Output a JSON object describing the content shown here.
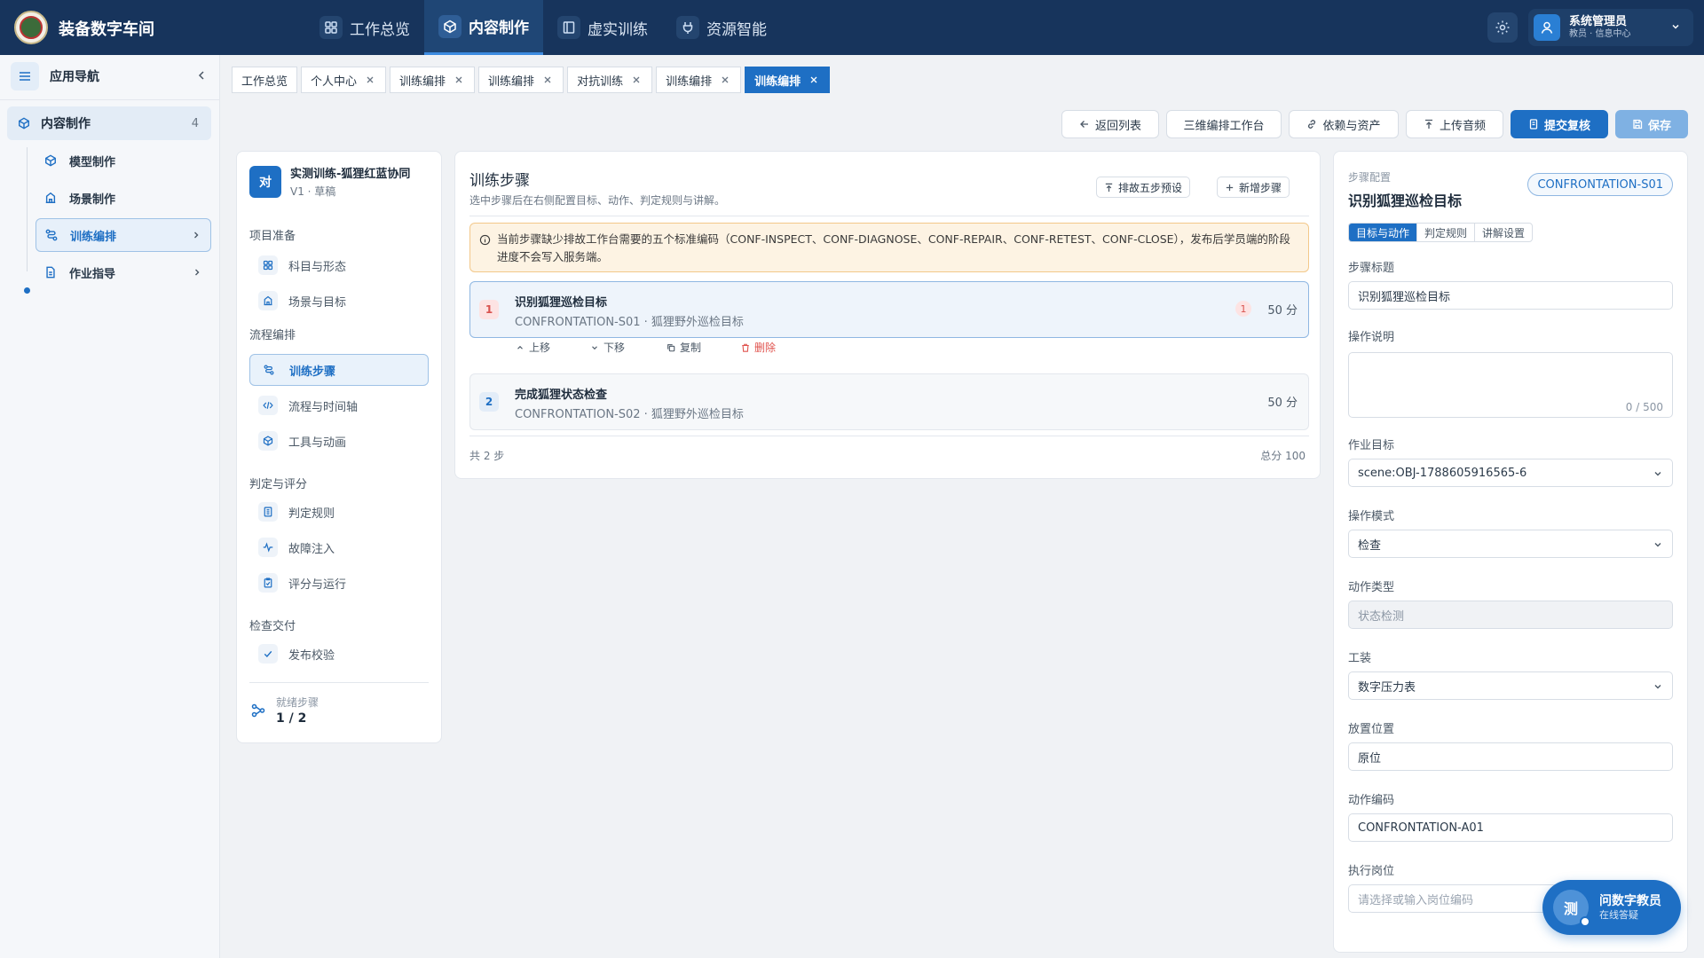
{
  "app": {
    "title": "装备数字车间"
  },
  "topnav": [
    {
      "label": "工作总览",
      "icon": "grid-icon"
    },
    {
      "label": "内容制作",
      "icon": "cube-icon"
    },
    {
      "label": "虚实训练",
      "icon": "book-icon"
    },
    {
      "label": "资源智能",
      "icon": "plug-icon"
    }
  ],
  "user": {
    "name": "系统管理员",
    "sub": "教员 · 信息中心"
  },
  "sidenav": {
    "title": "应用导航",
    "group": {
      "label": "内容制作",
      "count": "4"
    },
    "items": [
      {
        "label": "模型制作",
        "icon": "cube-icon"
      },
      {
        "label": "场景制作",
        "icon": "building-icon"
      },
      {
        "label": "训练编排",
        "icon": "flow-icon"
      },
      {
        "label": "作业指导",
        "icon": "document-icon"
      }
    ]
  },
  "tabs": [
    "工作总览",
    "个人中心",
    "训练编排",
    "训练编排",
    "对抗训练",
    "训练编排",
    "训练编排"
  ],
  "actions": {
    "back": "返回列表",
    "workbench": "三维编排工作台",
    "deps": "依赖与资产",
    "upload": "上传音频",
    "submit": "提交复核",
    "save": "保存"
  },
  "project": {
    "avatar": "对",
    "name": "实测训练-狐狸红蓝协同",
    "version": "V1 · 草稿",
    "sections": [
      {
        "title": "项目准备",
        "items": [
          "科目与形态",
          "场景与目标"
        ]
      },
      {
        "title": "流程编排",
        "items": [
          "训练步骤",
          "流程与时间轴",
          "工具与动画"
        ]
      },
      {
        "title": "判定与评分",
        "items": [
          "判定规则",
          "故障注入",
          "评分与运行"
        ]
      },
      {
        "title": "检查交付",
        "items": [
          "发布校验"
        ]
      }
    ],
    "ready_label": "就绪步骤",
    "ready_value": "1 / 2"
  },
  "steps": {
    "title": "训练步骤",
    "subtitle": "选中步骤后在右侧配置目标、动作、判定规则与讲解。",
    "preset_btn": "排故五步预设",
    "add_btn": "新增步骤",
    "warning": "当前步骤缺少排故工作台需要的五个标准编码（CONF-INSPECT、CONF-DIAGNOSE、CONF-REPAIR、CONF-RETEST、CONF-CLOSE），发布后学员端的阶段进度不会写入服务端。",
    "list": [
      {
        "num": "1",
        "name": "识别狐狸巡检目标",
        "code": "CONFRONTATION-S01 · 狐狸野外巡检目标",
        "badge": "1",
        "score": "50 分"
      },
      {
        "num": "2",
        "name": "完成狐狸状态检查",
        "code": "CONFRONTATION-S02 · 狐狸野外巡检目标",
        "score": "50 分"
      }
    ],
    "step_actions": {
      "up": "上移",
      "down": "下移",
      "copy": "复制",
      "delete": "删除"
    },
    "count": "共 2 步",
    "total": "总分 100"
  },
  "config": {
    "label": "步骤配置",
    "title": "识别狐狸巡检目标",
    "code": "CONFRONTATION-S01",
    "tabs": [
      "目标与动作",
      "判定规则",
      "讲解设置"
    ],
    "fields": {
      "step_title_label": "步骤标题",
      "step_title": "识别狐狸巡检目标",
      "desc_label": "操作说明",
      "desc_count": "0 / 500",
      "target_label": "作业目标",
      "target": "scene:OBJ-1788605916565-6",
      "mode_label": "操作模式",
      "mode": "检查",
      "action_type_label": "动作类型",
      "action_type": "状态检测",
      "tool_label": "工装",
      "tool": "数字压力表",
      "place_label": "放置位置",
      "place": "原位",
      "action_code_label": "动作编码",
      "action_code": "CONFRONTATION-A01",
      "post_label": "执行岗位",
      "post_placeholder": "请选择或输入岗位编码"
    }
  },
  "assistant": {
    "avatar": "测",
    "title": "问数字教员",
    "sub": "在线答疑"
  },
  "colors": {
    "topbar": "#17345c",
    "primary": "#1e6fc4",
    "warning_bg": "#fdf3e3",
    "danger": "#e0534e"
  }
}
